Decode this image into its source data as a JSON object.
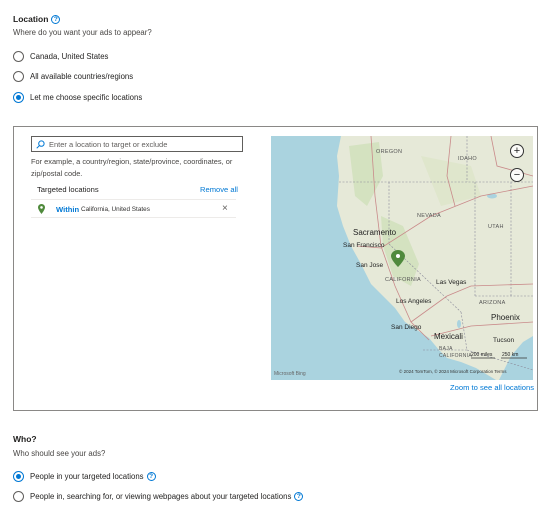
{
  "location": {
    "title": "Location",
    "question": "Where do you want your ads to appear?",
    "options": [
      {
        "label": "Canada, United States",
        "selected": false
      },
      {
        "label": "All available countries/regions",
        "selected": false
      },
      {
        "label": "Let me choose specific locations",
        "selected": true
      }
    ]
  },
  "targeting": {
    "search_placeholder": "Enter a location to target or exclude",
    "hint": "For example, a country/region, state/province, coordinates, or zip/postal code.",
    "targeted_header": "Targeted locations",
    "remove_all": "Remove all",
    "items": [
      {
        "mode": "Within",
        "name": "California, United States"
      }
    ],
    "zoom_link": "Zoom to see all locations"
  },
  "map": {
    "labels": {
      "oregon": "OREGON",
      "idaho": "IDAHO",
      "nevada": "NEVADA",
      "utah": "UTAH",
      "sacramento": "Sacramento",
      "san_francisco": "San Francisco",
      "san_jose": "San Jose",
      "california": "CALIFORNIA",
      "las_vegas": "Las Vegas",
      "los_angeles": "Los Angeles",
      "arizona": "ARIZONA",
      "phoenix": "Phoenix",
      "san_diego": "San Diego",
      "mexicali": "Mexicali",
      "tucson": "Tucson",
      "baja": "BAJA CALIFORNIA",
      "scale_mi": "200 miles",
      "scale_km": "250 km",
      "copyright": "© 2024 TomTom, © 2024 Microsoft Corporation Terms",
      "brand": "Microsoft Bing"
    },
    "colors": {
      "water": "#aad3df",
      "land": "#e6e9d8",
      "pin": "#4f8a3c"
    }
  },
  "who": {
    "title": "Who?",
    "question": "Who should see your ads?",
    "options": [
      {
        "label": "People in your targeted locations",
        "selected": true
      },
      {
        "label": "People in, searching for, or viewing webpages about your targeted locations",
        "selected": false
      }
    ]
  }
}
